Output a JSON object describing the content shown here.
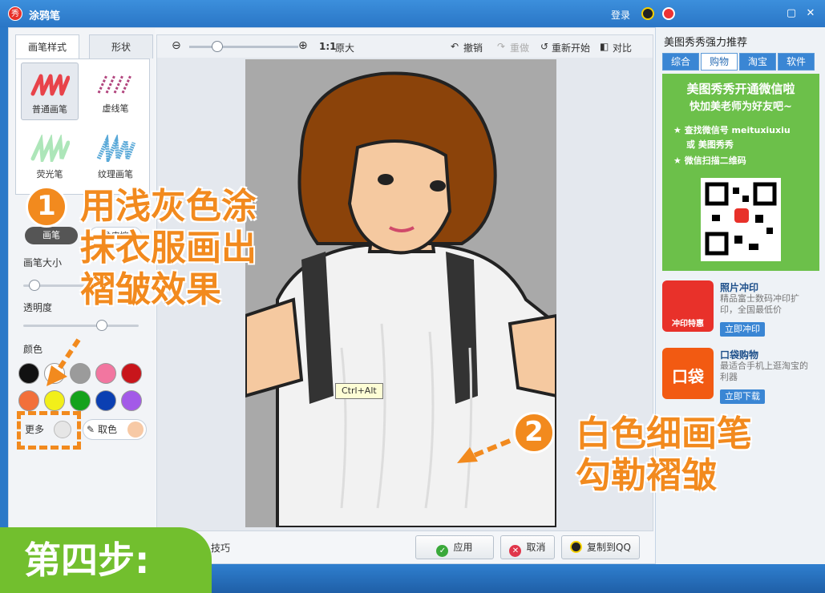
{
  "window": {
    "title": "涂鸦笔",
    "app_icon_text": "秀",
    "login_label": "登录"
  },
  "left_panel": {
    "tabs": [
      {
        "label": "画笔样式",
        "active": true
      },
      {
        "label": "形状",
        "active": false
      }
    ],
    "brushes": [
      {
        "label": "普通画笔",
        "color": "#e8434a"
      },
      {
        "label": "虚线笔",
        "color": "#b2457e"
      },
      {
        "label": "荧光笔",
        "color": "#98e0a8"
      },
      {
        "label": "纹理画笔",
        "color": "#5aa9d8"
      }
    ],
    "mode_tabs": [
      {
        "label": "画笔",
        "active": true
      },
      {
        "label": "橡皮擦",
        "active": false
      }
    ],
    "brush_size_label": "画笔大小",
    "brush_size_value": 0.05,
    "opacity_label": "透明度",
    "opacity_value": 0.7,
    "color_label": "颜色",
    "colors": [
      "#111111",
      "#ffffff",
      "#9b9b9b",
      "#f276a0",
      "#c8151b",
      "#f2703a",
      "#f2ef1a",
      "#14a21b",
      "#0b3fb2",
      "#a35ae8"
    ],
    "more_label": "更多",
    "picker_label": "取色",
    "tips_label": "技巧"
  },
  "canvas": {
    "zoom_ratio_label": "1:1",
    "original_size_label": "原大",
    "undo_label": "撤销",
    "redo_label": "重做",
    "restart_label": "重新开始",
    "compare_label": "对比",
    "tooltip": "Ctrl+Alt"
  },
  "actions": {
    "apply_label": "应用",
    "cancel_label": "取消",
    "copy_label": "复制到QQ"
  },
  "right_panel": {
    "heading": "美图秀秀强力推荐",
    "tabs": [
      {
        "label": "综合",
        "active": false
      },
      {
        "label": "购物",
        "active": true
      },
      {
        "label": "淘宝",
        "active": false
      },
      {
        "label": "软件",
        "active": false
      }
    ],
    "promo": {
      "title": "美图秀秀开通微信啦",
      "subtitle": "快加美老师为好友吧~",
      "line1": "查找微信号 meituxiuxiu",
      "line2": "或 美图秀秀",
      "line3": "微信扫描二维码"
    },
    "ads": [
      {
        "thumb_text": "冲印特惠",
        "name": "照片冲印",
        "desc": "精品富士数码冲印扩印，全国最低价",
        "button": "立即冲印",
        "color": "#e8312a"
      },
      {
        "thumb_text": "口袋",
        "name": "口袋购物",
        "desc": "最适合手机上逛淘宝的利器",
        "button": "立即下载",
        "color": "#f25a12"
      }
    ]
  },
  "annotations": {
    "step1_number": "1",
    "step1_line1": "用浅灰色涂",
    "step1_line2": "抹衣服画出",
    "step1_line3": "褶皱效果",
    "step2_number": "2",
    "step2_line1": "白色细画笔",
    "step2_line2": "勾勒褶皱",
    "step_badge": "第四步:"
  }
}
